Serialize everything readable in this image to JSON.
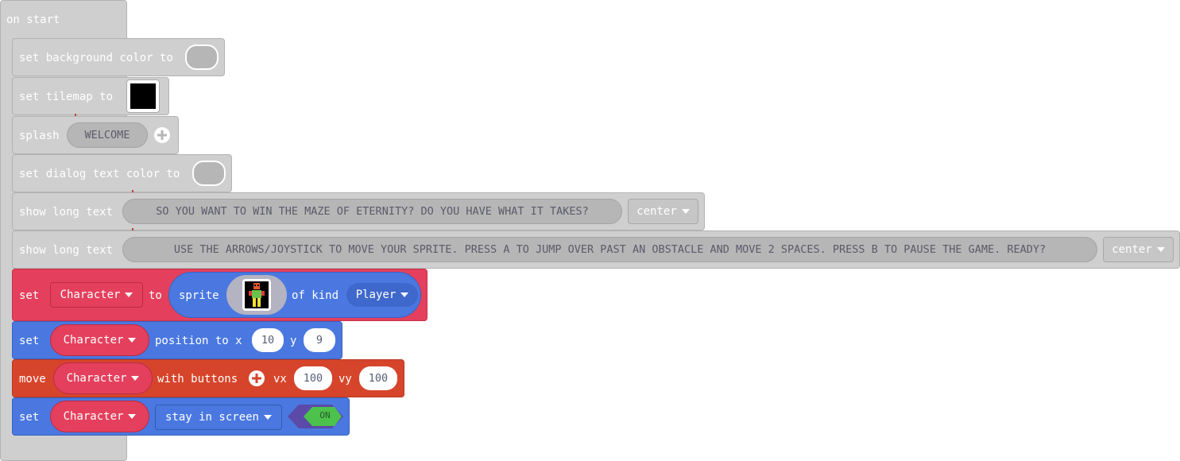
{
  "on_start": {
    "label": "on start"
  },
  "blocks": {
    "bg_color": {
      "label": "set background color to"
    },
    "tilemap": {
      "label": "set tilemap to"
    },
    "splash": {
      "label": "splash",
      "value": "WELCOME"
    },
    "dialog_color": {
      "label": "set dialog text color to"
    },
    "long_text_1": {
      "label": "show long text",
      "value": "SO YOU WANT TO WIN THE MAZE OF ETERNITY? DO YOU HAVE WHAT IT TAKES?",
      "align": "center"
    },
    "long_text_2": {
      "label": "show long text",
      "value": "USE THE ARROWS/JOYSTICK TO MOVE YOUR SPRITE. PRESS A TO JUMP OVER PAST AN OBSTACLE AND MOVE 2 SPACES. PRESS B TO PAUSE THE GAME. READY?",
      "align": "center"
    },
    "set_sprite": {
      "set": "set",
      "variable": "Character",
      "to": "to",
      "sprite": "sprite",
      "of_kind": "of kind",
      "kind": "Player"
    },
    "set_position": {
      "set": "set",
      "variable": "Character",
      "position_to": "position to x",
      "x": "10",
      "y_label": "y",
      "y": "9"
    },
    "move": {
      "move": "move",
      "variable": "Character",
      "with_buttons": "with buttons",
      "vx_label": "vx",
      "vx": "100",
      "vy_label": "vy",
      "vy": "100"
    },
    "stay": {
      "set": "set",
      "variable": "Character",
      "property": "stay in screen",
      "toggle": "ON"
    }
  },
  "colors": {
    "grey": "#cfcfcf",
    "red": "#e4405d",
    "blue": "#4a78e0",
    "orange": "#d6452b",
    "green": "#4cc24c"
  },
  "icons": {
    "add": "plus-circle-icon",
    "dropdown": "caret-down-icon"
  }
}
